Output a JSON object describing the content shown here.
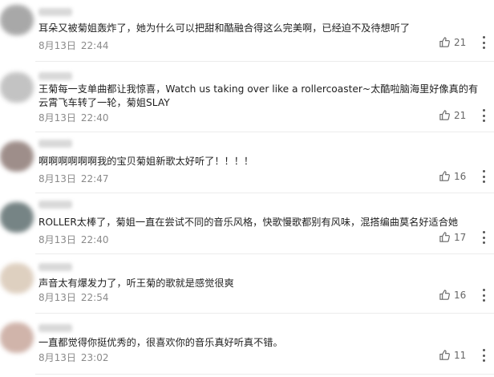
{
  "comments": [
    {
      "text": "耳朵又被菊姐轰炸了，她为什么可以把甜和酷融合得这么完美啊，已经迫不及待想听了",
      "date": "8月13日",
      "time": "22:44",
      "likes": "21",
      "avatar_color": "#9a9a9a"
    },
    {
      "text": "王菊每一支单曲都让我惊喜，Watch us taking over like a rollercoaster~太酷啦脑海里好像真的有云霄飞车转了一轮，菊姐SLAY",
      "date": "8月13日",
      "time": "22:40",
      "likes": "21",
      "avatar_color": "#b9b9b9"
    },
    {
      "text": "啊啊啊啊啊啊我的宝贝菊姐新歌太好听了！！！！",
      "date": "8月13日",
      "time": "22:47",
      "likes": "16",
      "avatar_color": "#8e7b76"
    },
    {
      "text": "ROLLER太棒了，菊姐一直在尝试不同的音乐风格，快歌慢歌都别有风味，混搭编曲莫名好适合她",
      "date": "8月13日",
      "time": "22:40",
      "likes": "17",
      "avatar_color": "#5f6f70"
    },
    {
      "text": "声音太有爆发力了，听王菊的歌就是感觉很爽",
      "date": "8月13日",
      "time": "22:54",
      "likes": "16",
      "avatar_color": "#d9c8b6"
    },
    {
      "text": "一直都觉得你挺优秀的，很喜欢你的音乐真好听真不错。",
      "date": "8月13日",
      "time": "23:02",
      "likes": "11",
      "avatar_color": "#c8a79c"
    }
  ]
}
